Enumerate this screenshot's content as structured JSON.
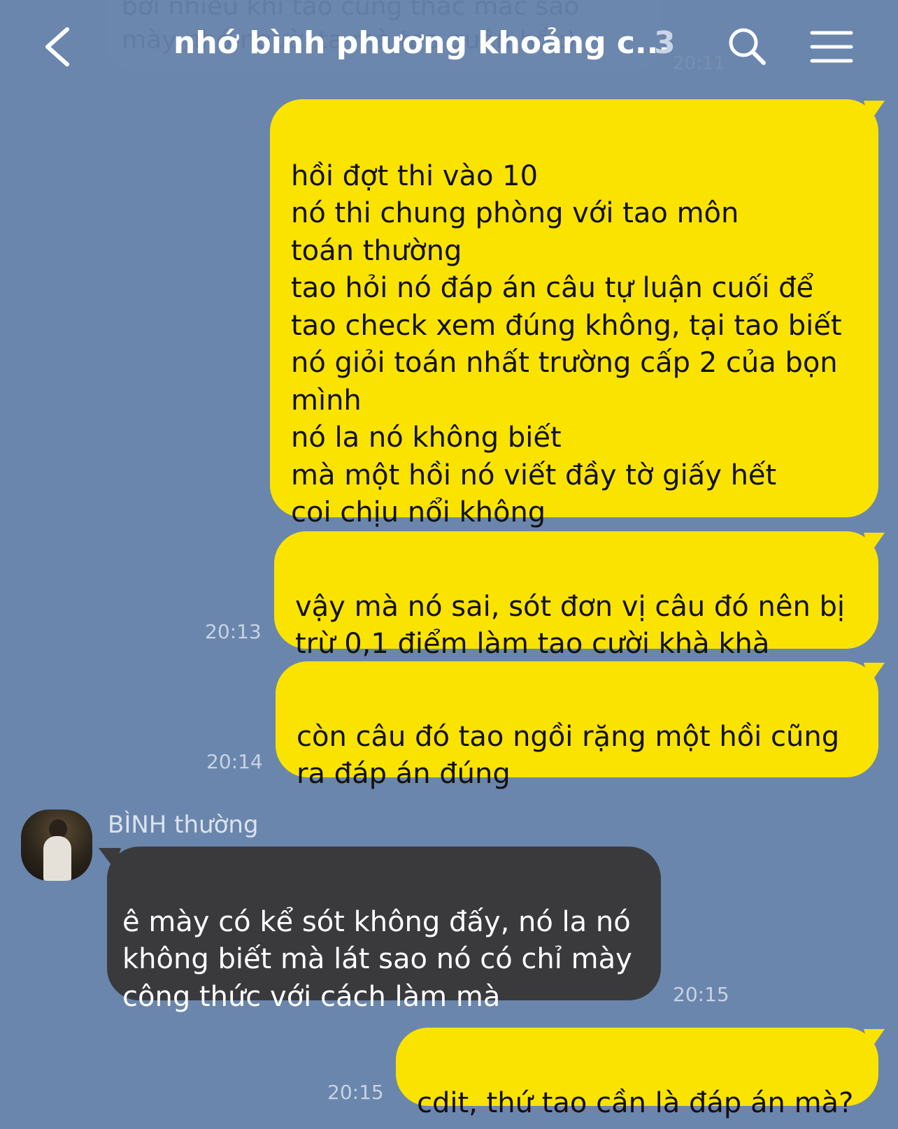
{
  "background_ghost": {
    "line1": "bởi nhiều khi tao cũng thắc mắc sao",
    "line2": "mày nhớ người ta mà tao quên hồi:)",
    "time": "20:11"
  },
  "header": {
    "title": "nhớ bình phương khoảng c...",
    "member_count": "3",
    "icons": [
      "back-icon",
      "search-icon",
      "menu-icon"
    ]
  },
  "messages": [
    {
      "side": "mine",
      "text": "hồi đợt thi vào 10\nnó thi chung phòng với tao môn\ntoán thường\ntao hỏi nó đáp án câu tự luận cuối để\ntao check xem đúng không, tại tao biết\nnó giỏi toán nhất trường cấp 2 của bọn\nmình\nnó la nó không biết\nmà một hồi nó viết đầy tờ giấy hết\ncoi chịu nổi không",
      "time": ""
    },
    {
      "side": "mine",
      "text": "vậy mà nó sai, sót đơn vị câu đó nên bị\ntrừ 0,1 điểm làm tao cười khà khà",
      "time": "20:13"
    },
    {
      "side": "mine",
      "text": "còn câu đó tao ngồi rặng một hồi cũng\nra đáp án đúng",
      "time": "20:14"
    },
    {
      "side": "theirs",
      "sender": "BÌNH thường",
      "text": "ê mày có kể sót không đấy, nó la nó\nkhông biết mà lát sao nó có chỉ mày\ncông thức với cách làm mà",
      "time": "20:15"
    },
    {
      "side": "mine",
      "text": "cdit, thứ tao cần là đáp án mà?",
      "time": "20:15"
    }
  ],
  "colors": {
    "background": "#6a86ad",
    "my_bubble": "#fbe300",
    "their_bubble": "#3a3a3d"
  }
}
